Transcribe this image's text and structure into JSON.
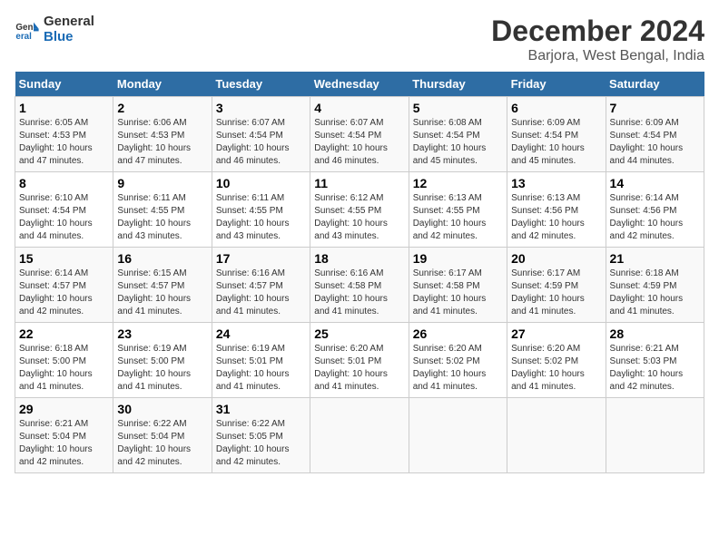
{
  "logo": {
    "line1": "General",
    "line2": "Blue"
  },
  "title": "December 2024",
  "subtitle": "Barjora, West Bengal, India",
  "weekdays": [
    "Sunday",
    "Monday",
    "Tuesday",
    "Wednesday",
    "Thursday",
    "Friday",
    "Saturday"
  ],
  "weeks": [
    [
      {
        "day": "1",
        "sunrise": "6:05 AM",
        "sunset": "4:53 PM",
        "daylight": "10 hours and 47 minutes."
      },
      {
        "day": "2",
        "sunrise": "6:06 AM",
        "sunset": "4:53 PM",
        "daylight": "10 hours and 47 minutes."
      },
      {
        "day": "3",
        "sunrise": "6:07 AM",
        "sunset": "4:54 PM",
        "daylight": "10 hours and 46 minutes."
      },
      {
        "day": "4",
        "sunrise": "6:07 AM",
        "sunset": "4:54 PM",
        "daylight": "10 hours and 46 minutes."
      },
      {
        "day": "5",
        "sunrise": "6:08 AM",
        "sunset": "4:54 PM",
        "daylight": "10 hours and 45 minutes."
      },
      {
        "day": "6",
        "sunrise": "6:09 AM",
        "sunset": "4:54 PM",
        "daylight": "10 hours and 45 minutes."
      },
      {
        "day": "7",
        "sunrise": "6:09 AM",
        "sunset": "4:54 PM",
        "daylight": "10 hours and 44 minutes."
      }
    ],
    [
      {
        "day": "8",
        "sunrise": "6:10 AM",
        "sunset": "4:54 PM",
        "daylight": "10 hours and 44 minutes."
      },
      {
        "day": "9",
        "sunrise": "6:11 AM",
        "sunset": "4:55 PM",
        "daylight": "10 hours and 43 minutes."
      },
      {
        "day": "10",
        "sunrise": "6:11 AM",
        "sunset": "4:55 PM",
        "daylight": "10 hours and 43 minutes."
      },
      {
        "day": "11",
        "sunrise": "6:12 AM",
        "sunset": "4:55 PM",
        "daylight": "10 hours and 43 minutes."
      },
      {
        "day": "12",
        "sunrise": "6:13 AM",
        "sunset": "4:55 PM",
        "daylight": "10 hours and 42 minutes."
      },
      {
        "day": "13",
        "sunrise": "6:13 AM",
        "sunset": "4:56 PM",
        "daylight": "10 hours and 42 minutes."
      },
      {
        "day": "14",
        "sunrise": "6:14 AM",
        "sunset": "4:56 PM",
        "daylight": "10 hours and 42 minutes."
      }
    ],
    [
      {
        "day": "15",
        "sunrise": "6:14 AM",
        "sunset": "4:57 PM",
        "daylight": "10 hours and 42 minutes."
      },
      {
        "day": "16",
        "sunrise": "6:15 AM",
        "sunset": "4:57 PM",
        "daylight": "10 hours and 41 minutes."
      },
      {
        "day": "17",
        "sunrise": "6:16 AM",
        "sunset": "4:57 PM",
        "daylight": "10 hours and 41 minutes."
      },
      {
        "day": "18",
        "sunrise": "6:16 AM",
        "sunset": "4:58 PM",
        "daylight": "10 hours and 41 minutes."
      },
      {
        "day": "19",
        "sunrise": "6:17 AM",
        "sunset": "4:58 PM",
        "daylight": "10 hours and 41 minutes."
      },
      {
        "day": "20",
        "sunrise": "6:17 AM",
        "sunset": "4:59 PM",
        "daylight": "10 hours and 41 minutes."
      },
      {
        "day": "21",
        "sunrise": "6:18 AM",
        "sunset": "4:59 PM",
        "daylight": "10 hours and 41 minutes."
      }
    ],
    [
      {
        "day": "22",
        "sunrise": "6:18 AM",
        "sunset": "5:00 PM",
        "daylight": "10 hours and 41 minutes."
      },
      {
        "day": "23",
        "sunrise": "6:19 AM",
        "sunset": "5:00 PM",
        "daylight": "10 hours and 41 minutes."
      },
      {
        "day": "24",
        "sunrise": "6:19 AM",
        "sunset": "5:01 PM",
        "daylight": "10 hours and 41 minutes."
      },
      {
        "day": "25",
        "sunrise": "6:20 AM",
        "sunset": "5:01 PM",
        "daylight": "10 hours and 41 minutes."
      },
      {
        "day": "26",
        "sunrise": "6:20 AM",
        "sunset": "5:02 PM",
        "daylight": "10 hours and 41 minutes."
      },
      {
        "day": "27",
        "sunrise": "6:20 AM",
        "sunset": "5:02 PM",
        "daylight": "10 hours and 41 minutes."
      },
      {
        "day": "28",
        "sunrise": "6:21 AM",
        "sunset": "5:03 PM",
        "daylight": "10 hours and 42 minutes."
      }
    ],
    [
      {
        "day": "29",
        "sunrise": "6:21 AM",
        "sunset": "5:04 PM",
        "daylight": "10 hours and 42 minutes."
      },
      {
        "day": "30",
        "sunrise": "6:22 AM",
        "sunset": "5:04 PM",
        "daylight": "10 hours and 42 minutes."
      },
      {
        "day": "31",
        "sunrise": "6:22 AM",
        "sunset": "5:05 PM",
        "daylight": "10 hours and 42 minutes."
      },
      null,
      null,
      null,
      null
    ]
  ],
  "labels": {
    "sunrise": "Sunrise: ",
    "sunset": "Sunset: ",
    "daylight": "Daylight: "
  }
}
